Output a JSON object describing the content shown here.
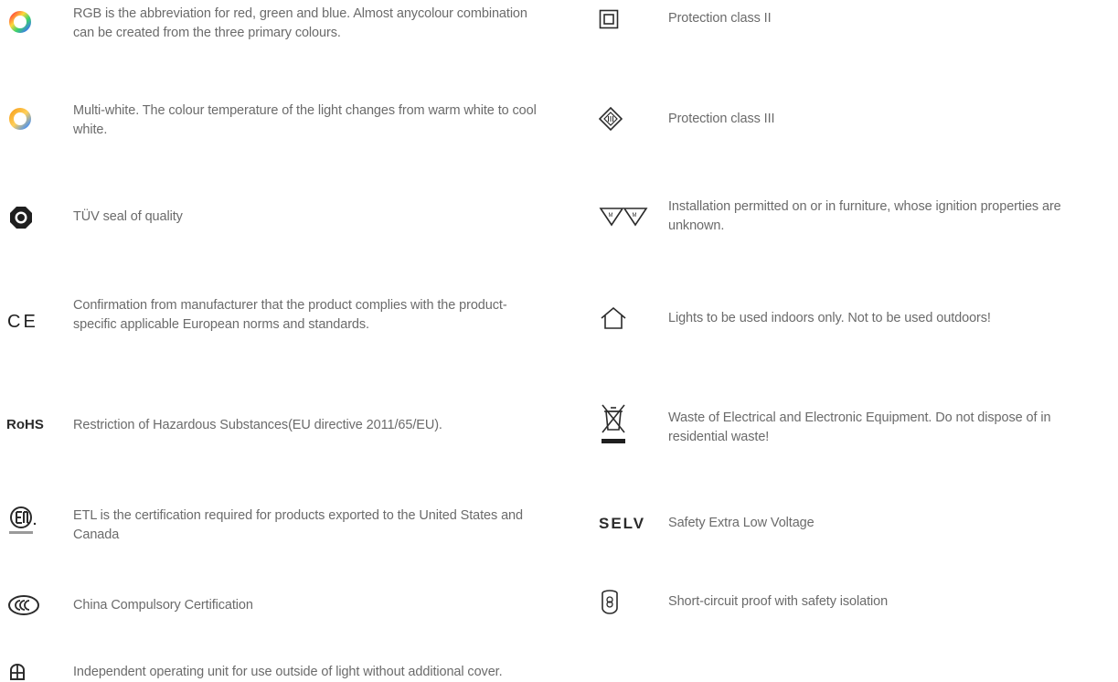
{
  "left": [
    {
      "id": "rgb",
      "icon": "rgb-color-ring-icon",
      "text": "RGB is the abbreviation for red, green and blue. Almost anycolour combination can be created from the three primary colours."
    },
    {
      "id": "multiwhite",
      "icon": "multi-white-ring-icon",
      "text": "Multi-white. The colour temperature of the light changes from warm white to cool white."
    },
    {
      "id": "tuv",
      "icon": "tuv-seal-icon",
      "text": "TÜV seal of quality"
    },
    {
      "id": "ce",
      "icon": "ce-mark-icon",
      "icon_text": "CE",
      "text": "Confirmation from manufacturer that the product complies with the product-specific applicable European norms and standards."
    },
    {
      "id": "rohs",
      "icon": "rohs-mark-icon",
      "icon_text": "RoHS",
      "text": "Restriction of Hazardous Substances(EU directive 2011/65/EU)."
    },
    {
      "id": "etl",
      "icon": "etl-mark-icon",
      "text": "ETL is the certification required for products exported to the United States and Canada"
    },
    {
      "id": "ccc",
      "icon": "ccc-mark-icon",
      "text": "China Compulsory Certification"
    },
    {
      "id": "ip",
      "icon": "independent-unit-icon",
      "text": "Independent operating unit for use outside of light without additional cover."
    }
  ],
  "right": [
    {
      "id": "class2",
      "icon": "protection-class-2-icon",
      "text": "Protection class II"
    },
    {
      "id": "class3",
      "icon": "protection-class-3-icon",
      "text": "Protection class III"
    },
    {
      "id": "furniture",
      "icon": "furniture-mounting-icon",
      "text": "Installation permitted on or in furniture, whose ignition properties are unknown."
    },
    {
      "id": "indoor",
      "icon": "indoor-house-icon",
      "text": "Lights to be used indoors only. Not to be used outdoors!"
    },
    {
      "id": "weee",
      "icon": "crossed-bin-icon",
      "text": "Waste of Electrical and Electronic Equipment. Do not dispose of in residential waste!"
    },
    {
      "id": "selv",
      "icon": "selv-mark-icon",
      "icon_text": "SELV",
      "text": "Safety Extra Low Voltage"
    },
    {
      "id": "shortcircuit",
      "icon": "short-circuit-transformer-icon",
      "text": "Short-circuit proof with safety isolation"
    }
  ],
  "colors": {
    "text": "#6b6b6b",
    "icon": "#2b2b2b"
  }
}
